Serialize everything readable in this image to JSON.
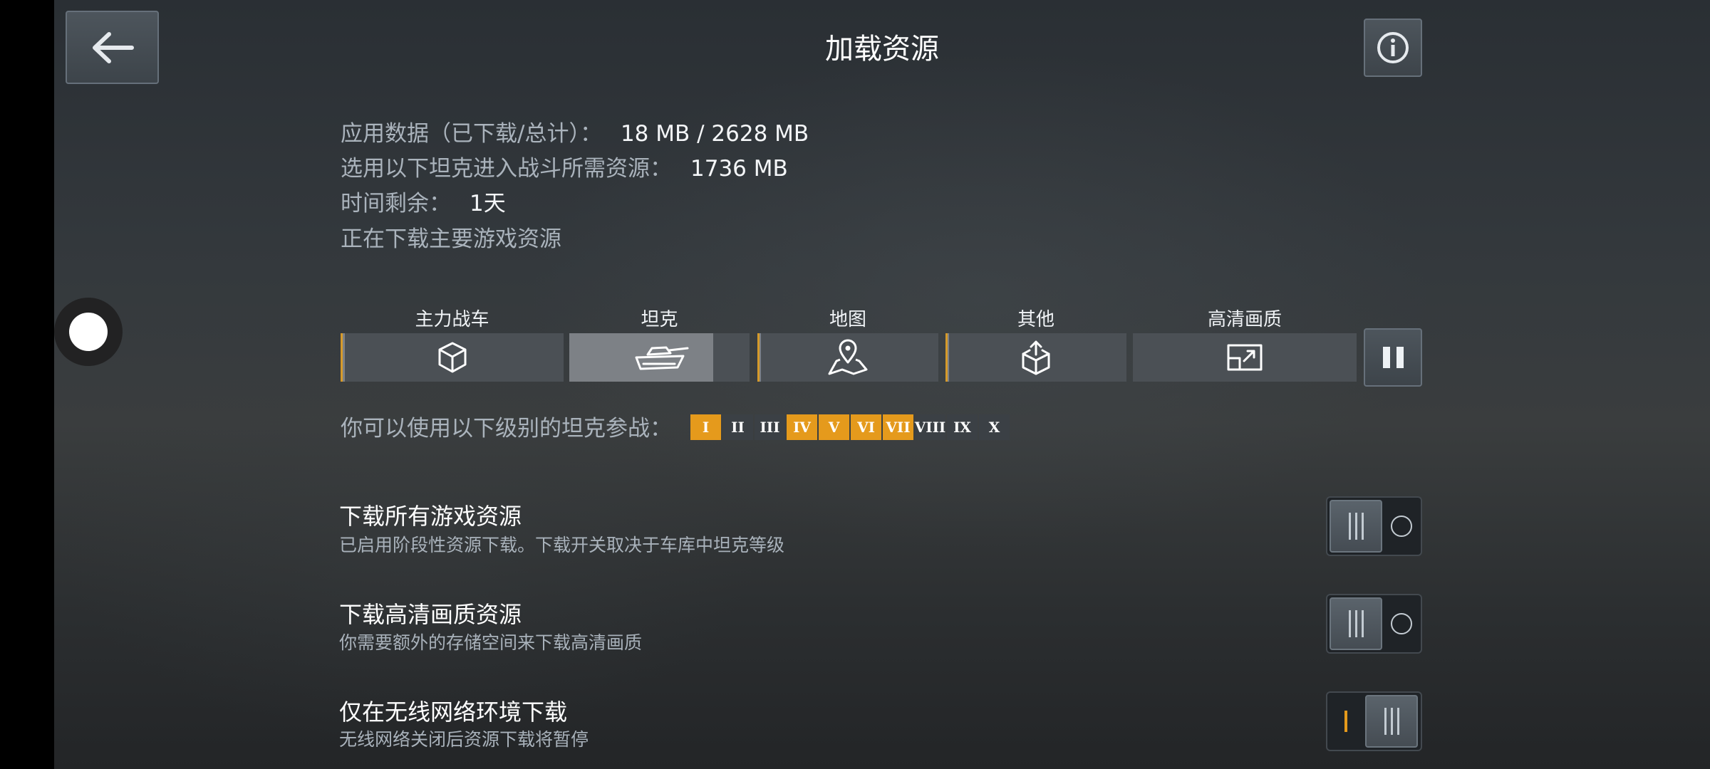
{
  "header": {
    "title": "加载资源",
    "back_icon": "arrow-left-icon",
    "info_icon": "info-circle-icon"
  },
  "status": {
    "app_data_label": "应用数据（已下载/总计）：",
    "app_data_value": "18 MB / 2628 MB",
    "battle_res_label": "选用以下坦克进入战斗所需资源：",
    "battle_res_value": "1736 MB",
    "time_label": "时间剩余：",
    "time_value": "1天",
    "downloading_text": "正在下载主要游戏资源"
  },
  "categories": [
    {
      "label": "主力战车",
      "icon": "cube-icon",
      "progress": 0.02,
      "accent": true
    },
    {
      "label": "坦克",
      "icon": "tank-icon",
      "progress": 0.8,
      "accent": false
    },
    {
      "label": "地图",
      "icon": "map-pin-icon",
      "progress": 0.02,
      "accent": true
    },
    {
      "label": "其他",
      "icon": "box-upload-icon",
      "progress": 0.02,
      "accent": true
    },
    {
      "label": "高清画质",
      "icon": "hd-screen-icon",
      "progress": 0.0,
      "accent": false
    }
  ],
  "pause_icon": "pause-icon",
  "tiers": {
    "label": "你可以使用以下级别的坦克参战：",
    "items": [
      {
        "label": "I",
        "active": true
      },
      {
        "label": "II",
        "active": false
      },
      {
        "label": "III",
        "active": false
      },
      {
        "label": "IV",
        "active": true
      },
      {
        "label": "V",
        "active": true
      },
      {
        "label": "VI",
        "active": true
      },
      {
        "label": "VII",
        "active": true
      },
      {
        "label": "VIII",
        "active": false
      },
      {
        "label": "IX",
        "active": false
      },
      {
        "label": "X",
        "active": false
      }
    ]
  },
  "settings": [
    {
      "title": "下载所有游戏资源",
      "desc": "已启用阶段性资源下载。下载开关取决于车库中坦克等级",
      "enabled": false
    },
    {
      "title": "下载高清画质资源",
      "desc": "你需要额外的存储空间来下载高清画质",
      "enabled": false
    },
    {
      "title": "仅在无线网络环境下载",
      "desc": "无线网络关闭后资源下载将暂停",
      "enabled": true
    }
  ],
  "colors": {
    "accent": "#e59a1c",
    "bar_fill": "#7d8186",
    "bar_track": "#4b5055"
  }
}
